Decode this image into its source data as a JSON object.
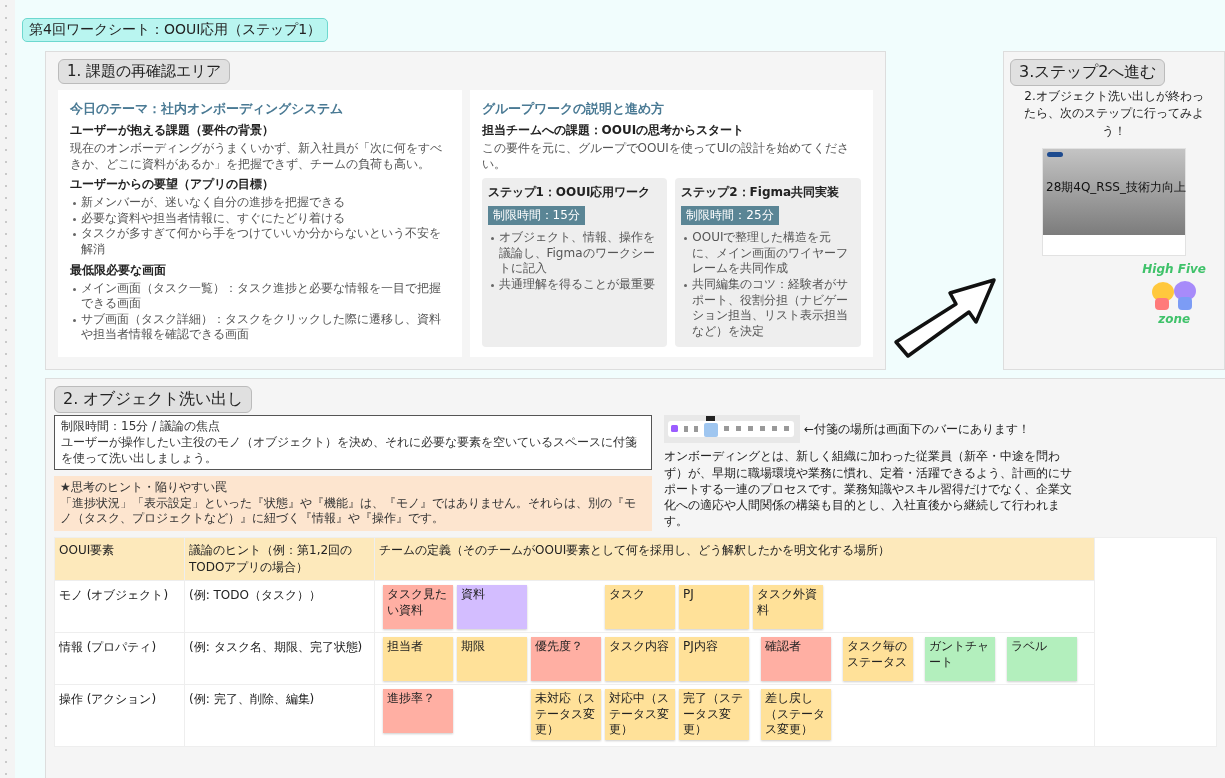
{
  "title_badge": "第4回ワークシート：OOUI応用（ステップ1）",
  "section1": {
    "label": "1. 課題の再確認エリア",
    "card_left": {
      "title": "今日のテーマ：社内オンボーディングシステム",
      "blocks": [
        {
          "heading": "ユーザーが抱える課題（要件の背景）",
          "text": "現在のオンボーディングがうまくいかず、新入社員が「次に何をすべきか、どこに資料があるか」を把握できず、チームの負荷も高い。"
        },
        {
          "heading": "ユーザーからの要望（アプリの目標）",
          "bullets": [
            "新メンバーが、迷いなく自分の進捗を把握できる",
            "必要な資料や担当者情報に、すぐにたどり着ける",
            "タスクが多すぎて何から手をつけていいか分からないという不安を解消"
          ]
        },
        {
          "heading": "最低限必要な画面",
          "bullets": [
            "メイン画面（タスク一覧）：タスク進捗と必要な情報を一目で把握できる画面",
            "サブ画面（タスク詳細）：タスクをクリックした際に遷移し、資料や担当者情報を確認できる画面"
          ]
        }
      ]
    },
    "card_right": {
      "title": "グループワークの説明と進め方",
      "heading": "担当チームへの課題：OOUIの思考からスタート",
      "text": "この要件を元に、グループでOOUIを使ってUIの設計を始めてください。",
      "steps": [
        {
          "title": "ステップ1：OOUI応用ワーク",
          "time": "制限時間：15分",
          "bullets": [
            "オブジェクト、情報、操作を議論し、Figmaのワークシートに記入",
            "共通理解を得ることが最重要"
          ]
        },
        {
          "title": "ステップ2：Figma共同実装",
          "time": "制限時間：25分",
          "bullets": [
            "OOUIで整理した構造を元に、メイン画面のワイヤーフレームを共同作成",
            "共同編集のコツ：経験者がサポート、役割分担（ナビゲーション担当、リスト表示担当など）を決定"
          ]
        }
      ]
    }
  },
  "section3": {
    "label": "3.ステップ2へ進む",
    "text": "2.オブジェクト洗い出しが終わったら、次のステップに行ってみよう！",
    "thumbnail_title": "28期4Q_RSS_技術力向上",
    "sticker_top": "High Five",
    "sticker_bottom": "zone"
  },
  "section2": {
    "label": "2. オブジェクト洗い出し",
    "note_lines": [
      "制限時間：15分 / 議論の焦点",
      "ユーザーが操作したい主役のモノ（オブジェクト）を決め、それに必要な要素を空いているスペースに付箋を使って洗い出しましょう。"
    ],
    "hint_title": "★思考のヒント・陥りやすい罠",
    "hint_text": "「進捗状況」「表示設定」といった『状態』や『機能』は、『モノ』ではありません。それらは、別の『モノ（タスク、プロジェクトなど）』に紐づく『情報』や『操作』です。",
    "toolbar_note": "←付箋の場所は画面下のバーにあります！",
    "paragraph": "オンボーディングとは、新しく組織に加わった従業員（新卒・中途を問わず）が、早期に職場環境や業務に慣れ、定着・活躍できるよう、計画的にサポートする一連のプロセスです。業務知識やスキル習得だけでなく、企業文化への適応や人間関係の構築も目的とし、入社直後から継続して行われます。",
    "table": {
      "columns": [
        "OOUI要素",
        "議論のヒント（例：第1,2回のTODOアプリの場合）",
        "チームの定義（そのチームがOOUI要素として何を採用し、どう解釈したかを明文化する場所）"
      ],
      "rows": [
        {
          "element": "モノ (オブジェクト)",
          "hint": "(例: TODO（タスク））",
          "stickies": [
            {
              "text": "タスク見たい資料",
              "color": "#ffafa3"
            },
            {
              "text": "資料",
              "color": "#d3bdff"
            },
            {
              "text": "タスク",
              "color": "#ffe199"
            },
            {
              "text": "PJ",
              "color": "#ffe199"
            },
            {
              "text": "タスク外資料",
              "color": "#ffe199"
            }
          ]
        },
        {
          "element": "情報 (プロパティ)",
          "hint": "(例: タスク名、期限、完了状態)",
          "stickies": [
            {
              "text": "担当者",
              "color": "#ffe199"
            },
            {
              "text": "期限",
              "color": "#ffe199"
            },
            {
              "text": "優先度？",
              "color": "#ffafa3"
            },
            {
              "text": "タスク内容",
              "color": "#ffe199"
            },
            {
              "text": "PJ内容",
              "color": "#ffe199"
            },
            {
              "text": "確認者",
              "color": "#ffafa3"
            },
            {
              "text": "タスク毎のステータス",
              "color": "#ffe199"
            },
            {
              "text": "ガントチャート",
              "color": "#b3efbd"
            },
            {
              "text": "ラベル",
              "color": "#b3efbd"
            }
          ]
        },
        {
          "element": "操作 (アクション)",
          "hint": "(例: 完了、削除、編集)",
          "stickies": [
            {
              "text": "進捗率？",
              "color": "#ffafa3"
            },
            {
              "text": "未対応（ステータス変更）",
              "color": "#ffe199"
            },
            {
              "text": "対応中（ステータス変更）",
              "color": "#ffe199"
            },
            {
              "text": "完了（ステータス変更）",
              "color": "#ffe199"
            },
            {
              "text": "差し戻し（ステータス変更）",
              "color": "#ffe199"
            }
          ]
        }
      ]
    }
  }
}
